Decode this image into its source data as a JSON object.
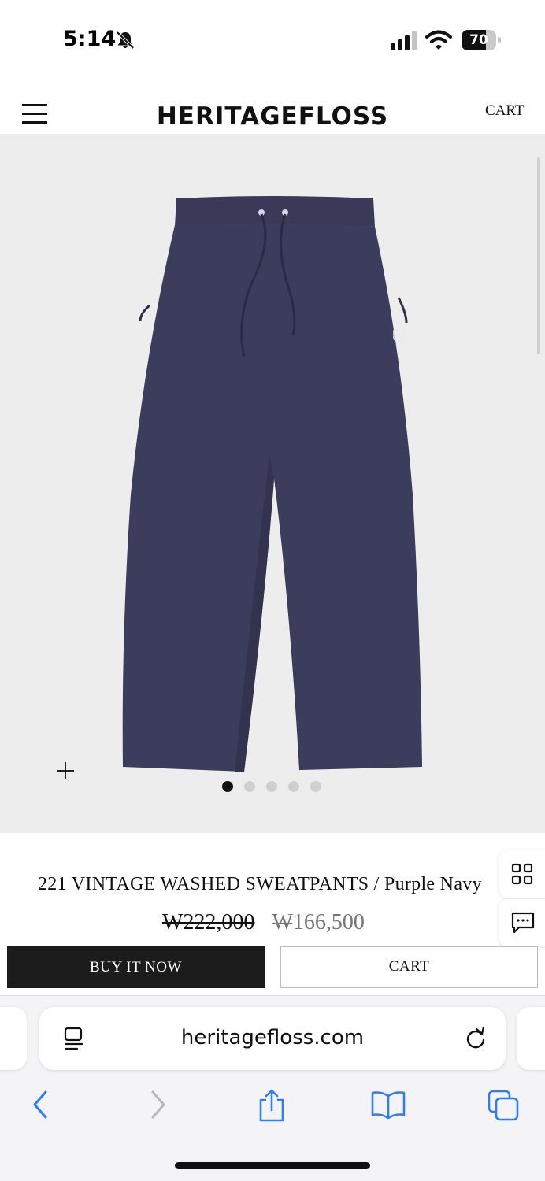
{
  "status_bar": {
    "time": "5:14",
    "battery_level": "70",
    "battery_fraction": 0.7,
    "icons": [
      "bell-slash-icon",
      "signal-icon",
      "wifi-icon",
      "battery-icon"
    ]
  },
  "header": {
    "brand": "HERITAGEFLOSS",
    "cart_label": "CART",
    "menu_icon": "hamburger-menu-icon"
  },
  "gallery": {
    "image_description": "navy sweatpants product photo",
    "slide_count": 5,
    "active_slide": 1,
    "zoom_icon": "plus-icon"
  },
  "product": {
    "title": "221 VINTAGE WASHED SWEATPANTS / Purple Navy",
    "original_price": "₩222,000",
    "sale_price": "₩166,500",
    "buy_now_label": "BUY IT NOW",
    "cart_label": "CART"
  },
  "side_buttons": [
    "grid-icon",
    "chat-icon"
  ],
  "browser": {
    "url": "heritagefloss.com",
    "toolbar_icons": [
      "back-icon",
      "forward-icon",
      "share-icon",
      "bookmarks-icon",
      "tabs-icon"
    ]
  },
  "colors": {
    "accent_dark": "#1c1c1c",
    "ios_blue": "#2f7cf6",
    "gallery_bg": "#ededed",
    "pants_navy": "#3b3b5a"
  }
}
